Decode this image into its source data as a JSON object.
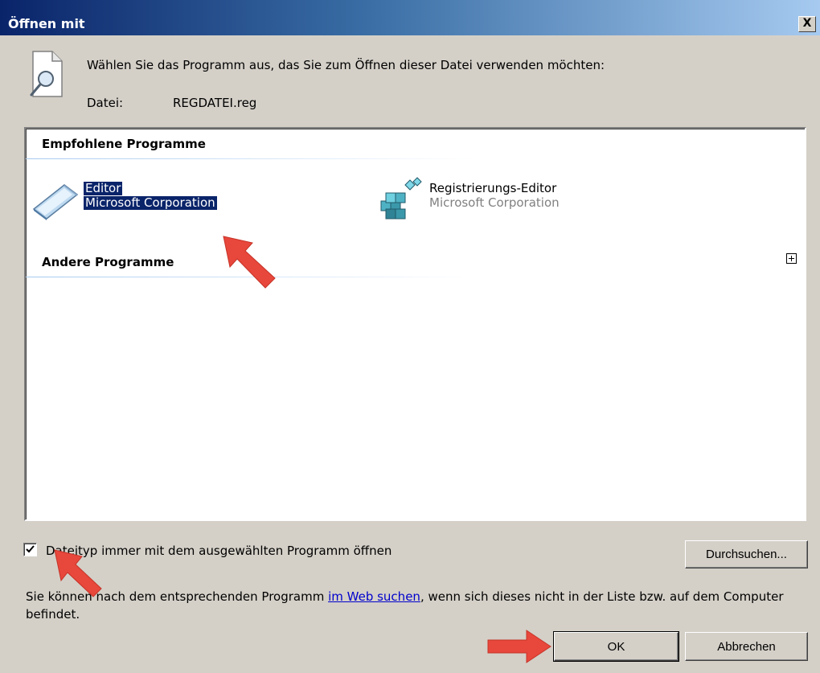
{
  "window": {
    "title": "Öffnen mit",
    "close_symbol": "X"
  },
  "header": {
    "instruction": "Wählen Sie das Programm aus, das Sie zum Öffnen dieser Datei verwenden möchten:",
    "file_label": "Datei:",
    "file_name": "REGDATEI.reg"
  },
  "list": {
    "recommended_header": "Empfohlene Programme",
    "other_header": "Andere Programme",
    "programs": [
      {
        "name": "Editor",
        "company": "Microsoft Corporation",
        "selected": true,
        "icon": "notepad-icon"
      },
      {
        "name": "Registrierungs-Editor",
        "company": "Microsoft Corporation",
        "selected": false,
        "icon": "regedit-icon"
      }
    ]
  },
  "options": {
    "always_use_label": "Dateityp immer mit dem ausgewählten Programm öffnen",
    "always_use_checked": true,
    "browse_label": "Durchsuchen..."
  },
  "info": {
    "text_before": "Sie können nach dem entsprechenden Programm ",
    "link_text": "im Web suchen",
    "text_after": ", wenn sich dieses nicht in der Liste bzw. auf dem Computer befindet."
  },
  "buttons": {
    "ok": "OK",
    "cancel": "Abbrechen"
  },
  "colors": {
    "selection": "#0a246a",
    "annotation_arrow": "#e8473b",
    "dialog_bg": "#d4d0c8"
  }
}
